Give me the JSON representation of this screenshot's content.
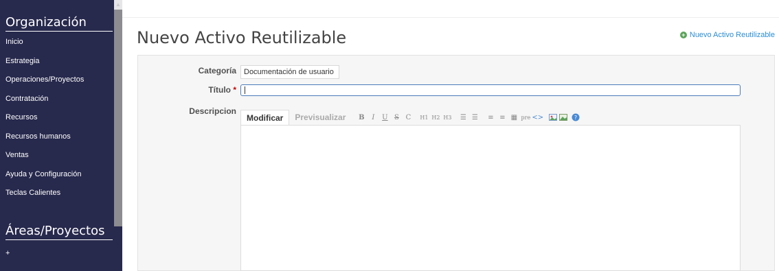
{
  "sidebar": {
    "section1_title": "Organización",
    "items": [
      {
        "label": "Inicio"
      },
      {
        "label": "Estrategia"
      },
      {
        "label": "Operaciones/Proyectos"
      },
      {
        "label": "Contratación"
      },
      {
        "label": "Recursos"
      },
      {
        "label": "Recursos humanos"
      },
      {
        "label": "Ventas"
      },
      {
        "label": "Ayuda y Configuración"
      },
      {
        "label": "Teclas Calientes"
      }
    ],
    "section2_title": "Áreas/Proyectos",
    "add_label": "+"
  },
  "header": {
    "title": "Nuevo Activo Reutilizable",
    "new_link": "Nuevo Activo Reutilizable"
  },
  "form": {
    "category_label": "Categoría",
    "category_value": "Documentación de usuario",
    "title_label": "Título",
    "required_mark": "*",
    "title_value": "",
    "description_label": "Descripcion",
    "editor": {
      "tab_edit": "Modificar",
      "tab_preview": "Previsualizar",
      "buttons": [
        "B",
        "I",
        "U",
        "S",
        "C",
        "H1",
        "H2",
        "H3",
        "ul",
        "ol",
        "left",
        "right",
        "table",
        "pre",
        "<>",
        "img",
        "image",
        "?"
      ]
    }
  },
  "colors": {
    "sidebar_bg": "#27294d",
    "link": "#2a8dd2",
    "add_icon": "#5aa35a",
    "required": "#cc0000",
    "input_focus": "#4a7ab8"
  }
}
